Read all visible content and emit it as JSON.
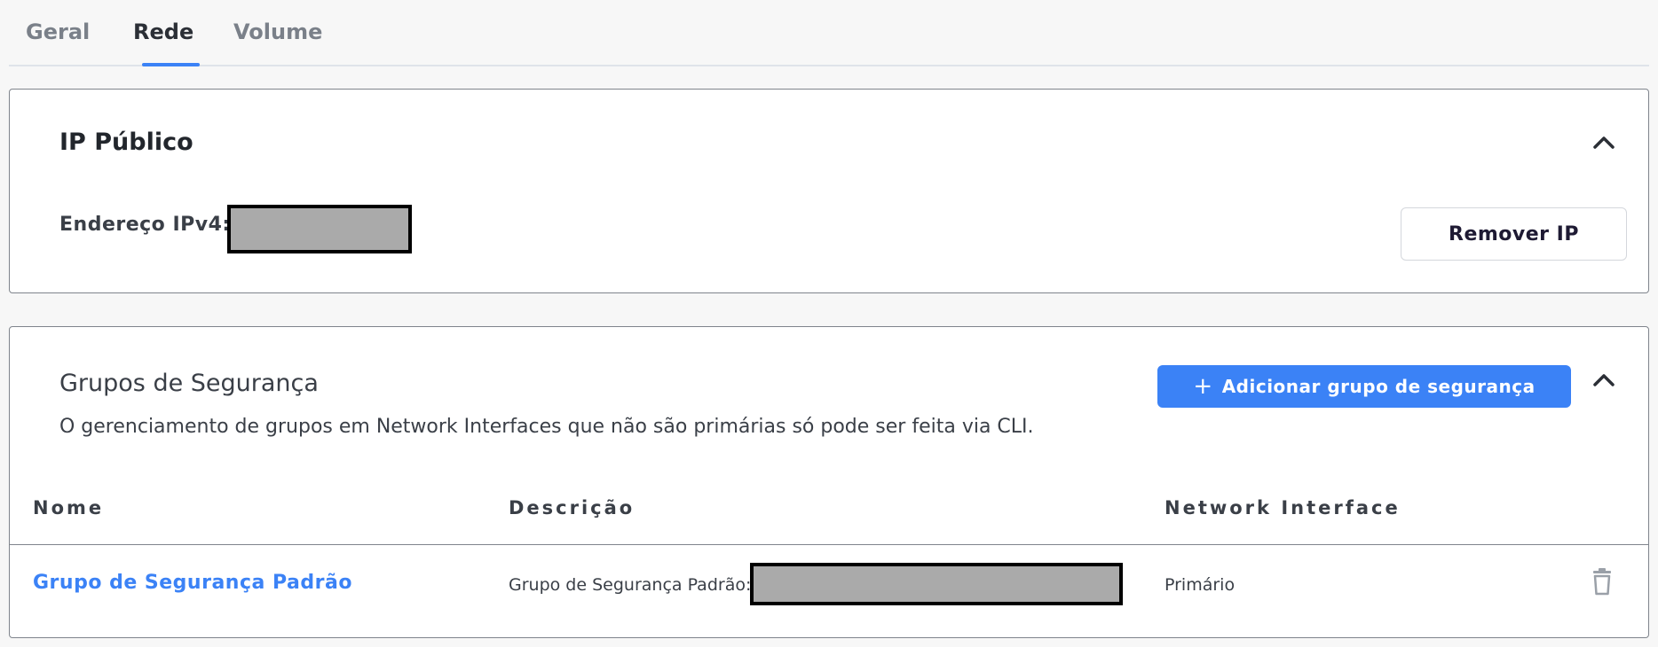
{
  "tabs": [
    {
      "label": "Geral",
      "active": false
    },
    {
      "label": "Rede",
      "active": true
    },
    {
      "label": "Volume",
      "active": false
    }
  ],
  "public_ip": {
    "title": "IP Público",
    "ipv4_label": "Endereço IPv4:",
    "ipv4_value": "",
    "remove_button": "Remover IP",
    "collapse_icon": "chevron-up-icon"
  },
  "security_groups": {
    "title": "Grupos de Segurança",
    "description": "O gerenciamento de grupos em Network Interfaces que não são primárias só pode ser feita via CLI.",
    "add_button": "Adicionar grupo de segurança",
    "add_icon": "plus-icon",
    "collapse_icon": "chevron-up-icon",
    "columns": [
      "Nome",
      "Descrição",
      "Network Interface"
    ],
    "rows": [
      {
        "name": "Grupo de Segurança Padrão",
        "description": "Grupo de Segurança Padrão:",
        "network_interface": "Primário",
        "action_icon": "trash-icon"
      }
    ]
  },
  "colors": {
    "accent": "#3b82f6",
    "redaction": "#aaaaaa"
  }
}
